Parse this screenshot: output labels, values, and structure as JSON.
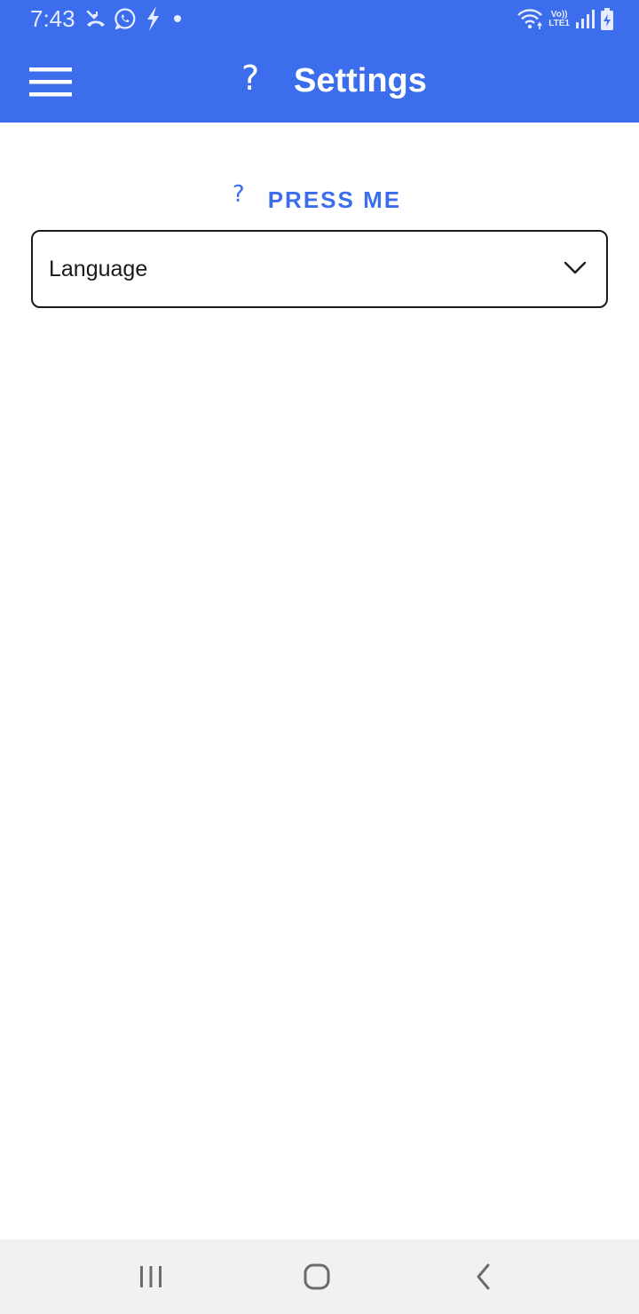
{
  "status_bar": {
    "time": "7:43",
    "lte_top": "Vo))",
    "lte_bottom": "LTE1",
    "icons_left": [
      "missed-call-icon",
      "whatsapp-icon",
      "flash-icon",
      "dot-icon"
    ],
    "icons_right": [
      "wifi-icon",
      "lte-icon",
      "signal-icon",
      "battery-icon"
    ]
  },
  "app_bar": {
    "title": "Settings",
    "help_glyph": "?",
    "menu_icon": "hamburger-icon",
    "background": "#3b6ded"
  },
  "content": {
    "press_me_glyph": "?",
    "press_me_label": "PRESS ME",
    "language_select": {
      "value": "Language",
      "icon": "chevron-down-icon"
    }
  },
  "nav_bar": {
    "icons": [
      "recents-icon",
      "home-icon",
      "back-icon"
    ]
  },
  "colors": {
    "accent": "#3b6ded",
    "text": "#1a1a1a",
    "nav_bg": "#f1f1f1"
  }
}
